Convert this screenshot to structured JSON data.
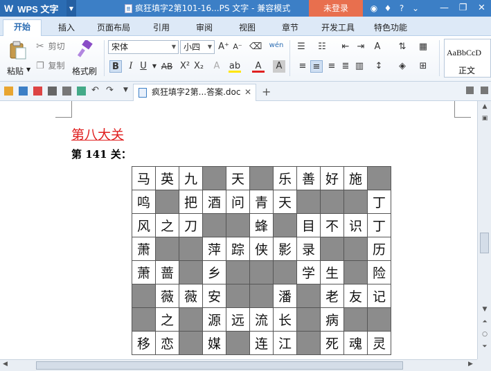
{
  "app": {
    "logo_mark": "W",
    "name": "WPS 文字",
    "window_title": "疯狂填字2第101-16...PS 文字 - 兼容模式",
    "login_label": "未登录"
  },
  "tabs": [
    {
      "label": "开始",
      "active": true
    },
    {
      "label": "插入"
    },
    {
      "label": "页面布局"
    },
    {
      "label": "引用"
    },
    {
      "label": "审阅"
    },
    {
      "label": "视图"
    },
    {
      "label": "章节"
    },
    {
      "label": "开发工具"
    },
    {
      "label": "特色功能"
    }
  ],
  "ribbon": {
    "paste_label": "粘贴",
    "cut_label": "剪切",
    "copy_label": "复制",
    "format_painter_label": "格式刷",
    "font_name": "宋体",
    "font_size": "小四",
    "style_preview": "AaBbCcD",
    "style_name": "正文"
  },
  "document_tab": {
    "title": "疯狂填字2第...答案.doc"
  },
  "document": {
    "heading": "第八大关",
    "subheading": "第 141 关：",
    "grid": [
      [
        "马",
        "英",
        "九",
        "",
        "天",
        "",
        "乐",
        "善",
        "好",
        "施",
        ""
      ],
      [
        "鸣",
        "",
        "把",
        "酒",
        "问",
        "青",
        "天",
        "",
        "",
        "",
        "丁"
      ],
      [
        "风",
        "之",
        "刀",
        "",
        "",
        "蜂",
        "",
        "目",
        "不",
        "识",
        "丁"
      ],
      [
        "萧",
        "",
        "",
        "萍",
        "踪",
        "侠",
        "影",
        "录",
        "",
        "",
        "历"
      ],
      [
        "萧",
        "蔷",
        "",
        "乡",
        "",
        "",
        "",
        "学",
        "生",
        "",
        "险"
      ],
      [
        "",
        "薇",
        "薇",
        "安",
        "",
        "",
        "潘",
        "",
        "老",
        "友",
        "记"
      ],
      [
        "",
        "之",
        "",
        "源",
        "远",
        "流",
        "长",
        "",
        "病",
        "",
        ""
      ],
      [
        "移",
        "恋",
        "",
        "媒",
        "",
        "连",
        "江",
        "",
        "死",
        "魂",
        "灵"
      ]
    ]
  },
  "colors": {
    "title_bar": "#3c7fc6",
    "login_button": "#e86f4e",
    "heading_red": "#e02020",
    "grid_gray": "#8c8c8c"
  }
}
